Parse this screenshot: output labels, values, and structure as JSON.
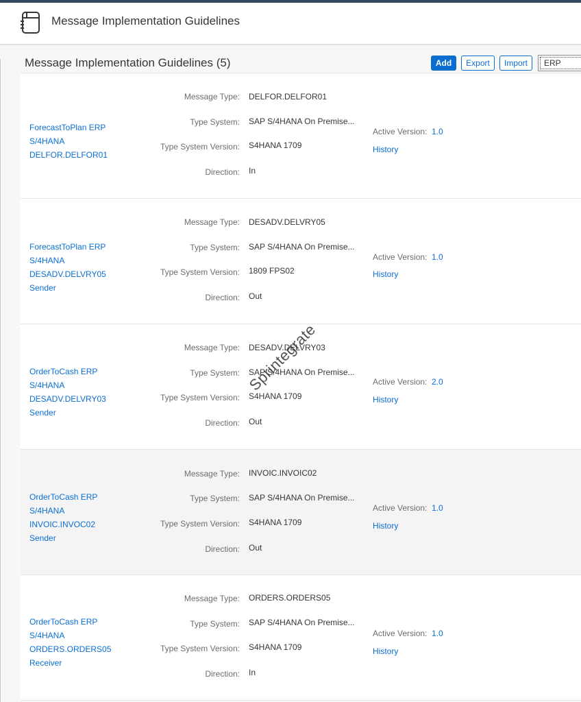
{
  "shell": {
    "title": "Message Implementation Guidelines",
    "icon": "notebook-icon"
  },
  "list": {
    "title": "Message Implementation Guidelines (5)",
    "add_label": "Add",
    "export_label": "Export",
    "import_label": "Import",
    "search_value": "ERP"
  },
  "labels": {
    "message_type": "Message Type:",
    "type_system": "Type System:",
    "type_system_version": "Type System Version:",
    "direction": "Direction:",
    "active_version": "Active Version:",
    "history": "History"
  },
  "rows": [
    {
      "name": [
        "ForecastToPlan ERP",
        "S/4HANA",
        "DELFOR.DELFOR01"
      ],
      "message_type": "DELFOR.DELFOR01",
      "type_system": "SAP S/4HANA On Premise...",
      "type_system_version": "S4HANA 1709",
      "direction": "In",
      "active_version": "1.0"
    },
    {
      "name": [
        "ForecastToPlan ERP",
        "S/4HANA",
        "DESADV.DELVRY05",
        "Sender"
      ],
      "message_type": "DESADV.DELVRY05",
      "type_system": "SAP S/4HANA On Premise...",
      "type_system_version": "1809 FPS02",
      "direction": "Out",
      "active_version": "1.0"
    },
    {
      "name": [
        "OrderToCash ERP",
        "S/4HANA",
        "DESADV.DELVRY03",
        "Sender"
      ],
      "message_type": "DESADV.DELVRY03",
      "type_system": "SAP S/4HANA On Premise...",
      "type_system_version": "S4HANA 1709",
      "direction": "Out",
      "active_version": "2.0"
    },
    {
      "name": [
        "OrderToCash ERP",
        "S/4HANA",
        "INVOIC.INVOC02",
        "Sender"
      ],
      "message_type": "INVOIC.INVOIC02",
      "type_system": "SAP S/4HANA On Premise...",
      "type_system_version": "S4HANA 1709",
      "direction": "Out",
      "active_version": "1.0"
    },
    {
      "name": [
        "OrderToCash ERP",
        "S/4HANA",
        "ORDERS.ORDERS05",
        "Receiver"
      ],
      "message_type": "ORDERS.ORDERS05",
      "type_system": "SAP S/4HANA On Premise...",
      "type_system_version": "S4HANA 1709",
      "direction": "In",
      "active_version": "1.0"
    }
  ],
  "watermark": "Sprintegrate"
}
